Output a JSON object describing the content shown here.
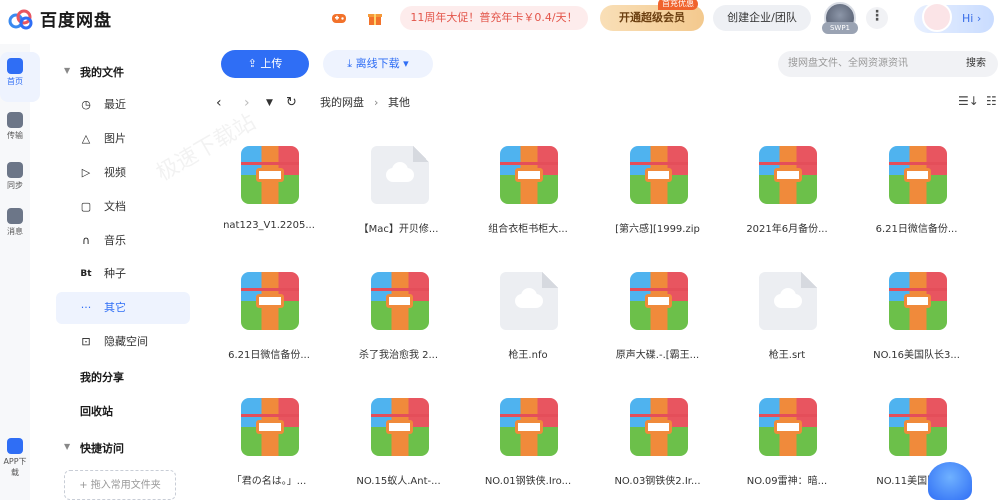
{
  "header": {
    "logo_text": "百度网盘",
    "promo_text": "11周年大促！普充年卡￥0.4/天！",
    "vip_button": "开通超级会员",
    "vip_tag": "首充优惠",
    "team_button": "创建企业/团队",
    "avatar_badge": "SWP1",
    "more": "⋮",
    "hi_text": "Hi ›"
  },
  "rail": {
    "items": [
      {
        "label": "首页",
        "icon": "home-cloud-icon"
      },
      {
        "label": "传输",
        "icon": "transfer-icon"
      },
      {
        "label": "同步",
        "icon": "sync-icon"
      },
      {
        "label": "消息",
        "icon": "message-icon"
      },
      {
        "label": "APP下载",
        "icon": "app-download-icon"
      }
    ]
  },
  "sidebar": {
    "my_files": "我的文件",
    "items": [
      {
        "label": "最近",
        "icon": "clock-icon",
        "glyph": "◷"
      },
      {
        "label": "图片",
        "icon": "image-icon",
        "glyph": "△"
      },
      {
        "label": "视频",
        "icon": "video-icon",
        "glyph": "▷"
      },
      {
        "label": "文档",
        "icon": "document-icon",
        "glyph": "▢"
      },
      {
        "label": "音乐",
        "icon": "headphones-icon",
        "glyph": "∩"
      },
      {
        "label": "种子",
        "icon": "bt-icon",
        "glyph": "Bt"
      },
      {
        "label": "其它",
        "icon": "more-icon",
        "glyph": "···"
      },
      {
        "label": "隐藏空间",
        "icon": "lock-icon",
        "glyph": "⊡"
      }
    ],
    "my_share": "我的分享",
    "recycle": "回收站",
    "quick_access": "快捷访问",
    "add_folder": "+ 拖入常用文件夹"
  },
  "toolbar": {
    "upload": "上传",
    "offline_download": "离线下载",
    "search_placeholder": "搜网盘文件、全网资源资讯",
    "search_label": "搜索"
  },
  "breadcrumb": {
    "root": "我的网盘",
    "separator": "›",
    "current": "其他"
  },
  "files": [
    {
      "name": "nat123_V1.2205...",
      "type": "zip"
    },
    {
      "name": "【Mac】开贝修...",
      "type": "cloud"
    },
    {
      "name": "组合衣柜书柜大...",
      "type": "zip"
    },
    {
      "name": "[第六感][1999.zip",
      "type": "zip"
    },
    {
      "name": "2021年6月备份...",
      "type": "zip"
    },
    {
      "name": "6.21日微信备份...",
      "type": "zip"
    },
    {
      "name": "6.21日微信备份...",
      "type": "zip"
    },
    {
      "name": "杀了我治愈我  2...",
      "type": "zip"
    },
    {
      "name": "枪王.nfo",
      "type": "cloud"
    },
    {
      "name": "原声大碟.-.[霸王...",
      "type": "zip"
    },
    {
      "name": "枪王.srt",
      "type": "cloud"
    },
    {
      "name": "NO.16美国队长3...",
      "type": "zip"
    },
    {
      "name": "「君の名は。」...",
      "type": "zip"
    },
    {
      "name": "NO.15蚁人.Ant-...",
      "type": "zip"
    },
    {
      "name": "NO.01钢铁侠.Iro...",
      "type": "zip"
    },
    {
      "name": "NO.03钢铁侠2.Ir...",
      "type": "zip"
    },
    {
      "name": "NO.09雷神：暗...",
      "type": "zip"
    },
    {
      "name": "NO.11美国队长...",
      "type": "zip"
    }
  ]
}
